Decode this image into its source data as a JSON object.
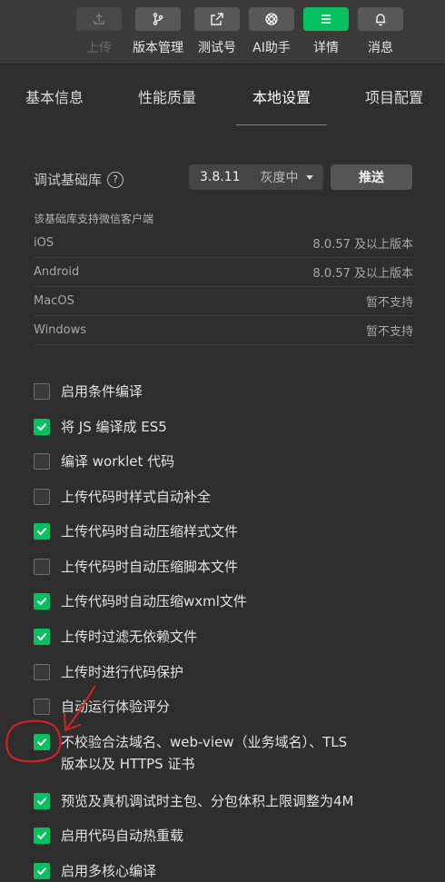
{
  "toolbar": {
    "items": [
      {
        "label": "上传",
        "icon": "upload-icon",
        "state": "disabled"
      },
      {
        "label": "版本管理",
        "icon": "branch-icon",
        "state": "normal"
      },
      {
        "label": "测试号",
        "icon": "external-link-icon",
        "state": "normal"
      },
      {
        "label": "AI助手",
        "icon": "ai-assistant-icon",
        "state": "normal"
      },
      {
        "label": "详情",
        "icon": "menu-icon",
        "state": "active"
      },
      {
        "label": "消息",
        "icon": "bell-icon",
        "state": "normal"
      }
    ]
  },
  "tabs": [
    {
      "label": "基本信息",
      "active": false
    },
    {
      "label": "性能质量",
      "active": false
    },
    {
      "label": "本地设置",
      "active": true
    },
    {
      "label": "项目配置",
      "active": false
    }
  ],
  "library": {
    "label": "调试基础库",
    "help_glyph": "?",
    "version": "3.8.11",
    "channel": "灰度中",
    "push_label": "推送"
  },
  "support": {
    "note": "该基础库支持微信客户端",
    "rows": [
      {
        "platform": "iOS",
        "value": "8.0.57 及以上版本"
      },
      {
        "platform": "Android",
        "value": "8.0.57 及以上版本"
      },
      {
        "platform": "MacOS",
        "value": "暂不支持"
      },
      {
        "platform": "Windows",
        "value": "暂不支持"
      }
    ]
  },
  "options": [
    {
      "label": "启用条件编译",
      "checked": false
    },
    {
      "label": "将 JS 编译成 ES5",
      "checked": true
    },
    {
      "label": "编译 worklet 代码",
      "checked": false
    },
    {
      "label": "上传代码时样式自动补全",
      "checked": false
    },
    {
      "label": "上传代码时自动压缩样式文件",
      "checked": true
    },
    {
      "label": "上传代码时自动压缩脚本文件",
      "checked": false
    },
    {
      "label": "上传代码时自动压缩wxml文件",
      "checked": true
    },
    {
      "label": "上传时过滤无依赖文件",
      "checked": true
    },
    {
      "label": "上传时进行代码保护",
      "checked": false
    },
    {
      "label": "自动运行体验评分",
      "checked": false
    },
    {
      "label": "不校验合法域名、web-view（业务域名）、TLS",
      "label2": "版本以及 HTTPS 证书",
      "checked": true
    },
    {
      "label": "预览及真机调试时主包、分包体积上限调整为4M",
      "checked": true
    },
    {
      "label": "启用代码自动热重载",
      "checked": true
    },
    {
      "label": "启用多核心编译",
      "checked": true
    }
  ],
  "colors": {
    "accent": "#07c160",
    "annotation": "#e02020"
  }
}
